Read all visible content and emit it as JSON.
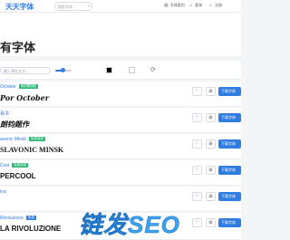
{
  "header": {
    "logo": "天天字体",
    "search_placeholder": "搜索字体...",
    "nav": [
      {
        "icon": "grid-icon",
        "glyph": "▦",
        "label": "字体类别"
      },
      {
        "icon": "user-icon",
        "glyph": "☺",
        "label": "登录"
      },
      {
        "icon": "user-plus-icon",
        "glyph": "☺",
        "label": "注册"
      }
    ]
  },
  "page": {
    "title": "有字体"
  },
  "toolbar": {
    "preview_placeholder": "输入预览文字...",
    "font_size_level": 0.45,
    "color_black": "#000000",
    "color_white": "#ffffff",
    "reset_glyph": "⟳"
  },
  "fonts": [
    {
      "name": "October",
      "badge": "商用需授权",
      "sample": "Por October",
      "style": "script"
    },
    {
      "name": "易书",
      "badge": "",
      "sample": "朗钧题作",
      "style": "script"
    },
    {
      "name": "avonic Minsk",
      "badge": "免费商用",
      "sample": "SLAVONIC MINSK",
      "style": "serif"
    },
    {
      "name": "Cool",
      "badge": "免费商用",
      "sample": "PERCOOL",
      "style": "bold"
    },
    {
      "name": "ina",
      "badge": "",
      "sample": "",
      "style": "bold"
    },
    {
      "name": "Rivoluzione",
      "badge": "免费",
      "sample": "LA RIVOLUZIONE",
      "style": "bold"
    }
  ],
  "download_label": "下载字体",
  "like_glyph": "♡",
  "cart_glyph": "⊞",
  "watermark": "链发SEO"
}
